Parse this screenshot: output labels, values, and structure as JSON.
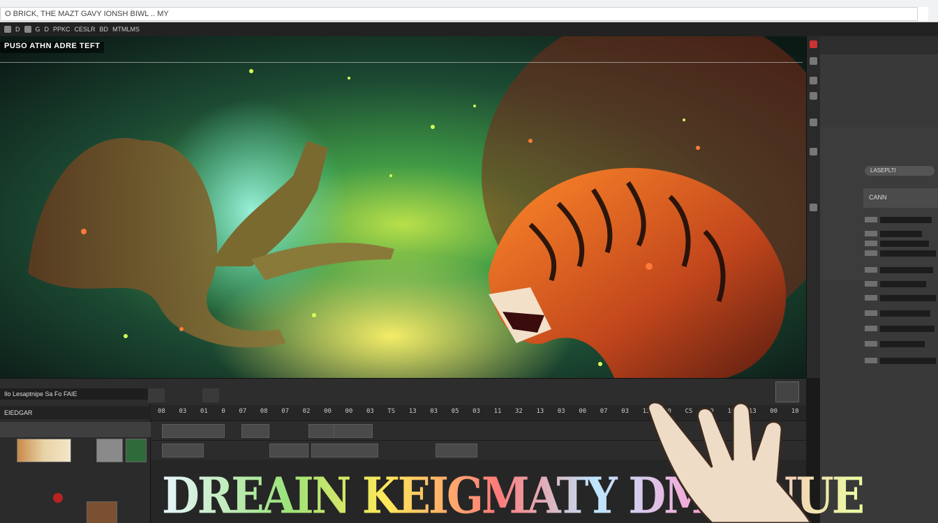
{
  "browser": {
    "address_text": "O BRICK, THE MAZT GAVY IONSH BIWL .. MY"
  },
  "menubar": {
    "items": [
      "D",
      "G",
      "D",
      "PPKC",
      "CESLR",
      "BD",
      "MTMLMS"
    ]
  },
  "viewport": {
    "title": "PUSO ATHN ADRE TEFT"
  },
  "right_panel": {
    "pill": "LASEPLTI",
    "header": "CANN"
  },
  "bottom": {
    "file_label": "Ilo Lesaptnipe Sa Fo FAIE",
    "bins_header": "EIEDGAR",
    "timecodes": [
      "08",
      "03",
      "01",
      "0",
      "07",
      "08",
      "07",
      "02",
      "00",
      "00",
      "03",
      "TS",
      "13",
      "03",
      "05",
      "03",
      "11",
      "32",
      "13",
      "03",
      "00",
      "07",
      "03",
      "13",
      "50",
      "CS",
      "00",
      "10",
      "13",
      "00",
      "10"
    ],
    "overlay_title": "DREAIN KEIGMATY DMIENUE"
  },
  "colors": {
    "accent_red": "#cc3333",
    "panel_bg": "#393939",
    "editor_bg": "#262626"
  }
}
